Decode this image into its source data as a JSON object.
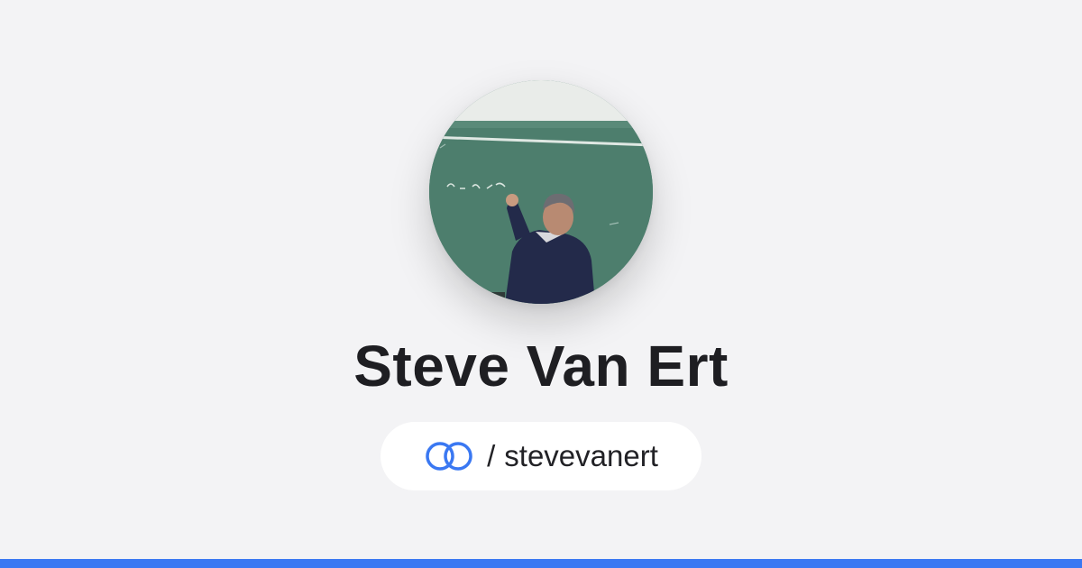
{
  "profile": {
    "name": "Steve Van Ert",
    "handle_separator": "/",
    "handle": "stevevanert",
    "avatar_icon": "profile-photo",
    "link_icon": "linked-rings-icon"
  },
  "colors": {
    "background": "#f3f3f5",
    "accent": "#3a78f2",
    "text": "#1e1e22",
    "pill": "#ffffff"
  }
}
